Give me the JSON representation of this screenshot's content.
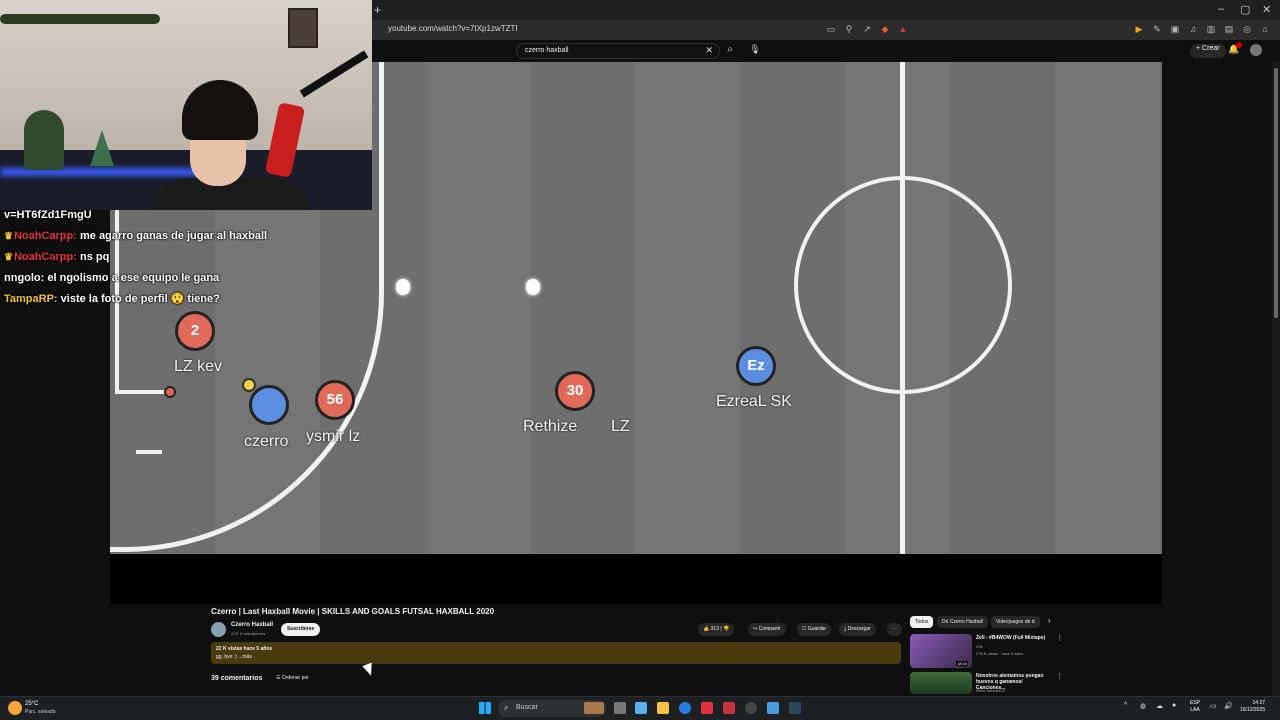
{
  "browser": {
    "new_tab": "+",
    "url": "youtube.com/watch?v=7tXp1zwTZTI",
    "window_controls": [
      "–",
      "▢",
      "✕"
    ]
  },
  "youtube": {
    "search_query": "czerro haxball",
    "create_label": "Crear",
    "video": {
      "title": "Czerro | Last Haxball Movie | SKILLS AND GOALS FUTSAL HAXBALL 2020",
      "channel": "Czerro Haxball",
      "subscribers": "2,57 K suscriptores",
      "subscribe_label": "Suscribirse",
      "likes": "313",
      "share_label": "Compartir",
      "save_label": "Guardar",
      "download_label": "Descargar",
      "views_date": "22 K vistas  hace 5 años",
      "description": "gg, bye :)  ...más",
      "comments_count": "39 comentarios",
      "sort_label": "Ordenar por"
    },
    "game": {
      "players": [
        {
          "label": "2",
          "name": "LZ kev",
          "team": "red"
        },
        {
          "label": "",
          "name": "czerro",
          "team": "blue"
        },
        {
          "label": "56",
          "name": "ysmir lz",
          "team": "red"
        },
        {
          "label": "30",
          "name": "Rethize",
          "team": "red"
        },
        {
          "label": "",
          "name": "LZ",
          "team": "none"
        },
        {
          "label": "Ez",
          "name": "EzreaL SK",
          "team": "blue"
        }
      ]
    },
    "chips": [
      "Todos",
      "De Czerro Haxball",
      "Videojuegos de d"
    ],
    "recommendations": [
      {
        "title": "Zell - #B4WOW (Full Mixtape)",
        "channel": "Zell",
        "meta": "276 K vistas · hace 3 años",
        "duration": "18:54"
      },
      {
        "title": "Nosotros alentamos pongan huevos q ganamos/ Canciones...",
        "channel": "Romi Xeneize12",
        "meta": "",
        "duration": ""
      }
    ]
  },
  "stream_chat": [
    {
      "user": "",
      "message": "v=HT6fZd1FmgU",
      "crown": false,
      "color": "#ffffff"
    },
    {
      "user": "NoahCarpp:",
      "message": "me agarro ganas de jugar al haxball",
      "crown": true,
      "color": "#e8323c"
    },
    {
      "user": "NoahCarpp:",
      "message": "ns pq",
      "crown": true,
      "color": "#e8323c"
    },
    {
      "user": "nngolo:",
      "message": "el ngolismo a ese equipo le gana",
      "crown": false,
      "color": "#ffffff"
    },
    {
      "user": "TampaRP:",
      "message": "viste la foto de perfil 😲 tiene?",
      "crown": false,
      "color": "#f0c22e"
    }
  ],
  "taskbar": {
    "weather_temp": "25°C",
    "weather_desc": "Parc. soleado",
    "search_label": "Buscar",
    "lang_top": "ESP",
    "lang_bottom": "LAA",
    "time": "14:27",
    "date": "16/12/2025"
  },
  "colors": {
    "red_team": "#e06a5a",
    "blue_team": "#5b8ee0",
    "youtube_bg": "#0f0f0f",
    "description_bg": "#4a3a10"
  }
}
